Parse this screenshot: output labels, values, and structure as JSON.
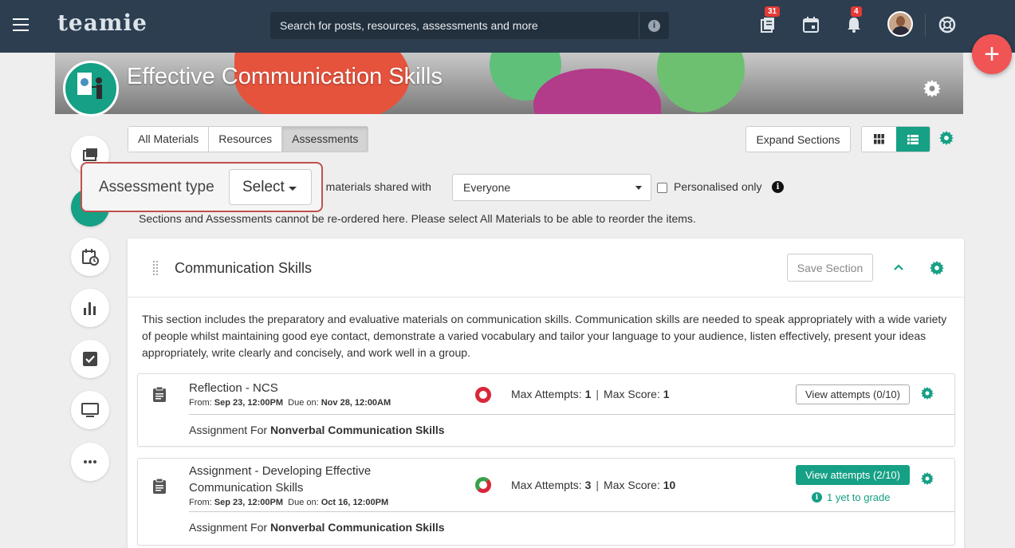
{
  "app": {
    "logo_text": "teamie",
    "accent_color": "#16a085",
    "topbar_color": "#2c3e50"
  },
  "search": {
    "placeholder": "Search for posts, resources, assessments and more",
    "info_icon": "info-icon"
  },
  "topbar": {
    "icons": [
      {
        "name": "materials-icon",
        "badge": "31"
      },
      {
        "name": "calendar-icon",
        "badge": ""
      },
      {
        "name": "bell-icon",
        "badge": "4"
      },
      {
        "name": "avatar",
        "badge": ""
      },
      {
        "name": "help-icon",
        "badge": ""
      }
    ]
  },
  "fab": {
    "label": "+"
  },
  "course": {
    "title": "Effective Communication Skills"
  },
  "tabs": [
    {
      "label": "All Materials",
      "active": false
    },
    {
      "label": "Resources",
      "active": false
    },
    {
      "label": "Assessments",
      "active": true
    }
  ],
  "toolbar": {
    "expand_label": "Expand Sections"
  },
  "filters": {
    "assessment_type_label": "Assessment type",
    "assessment_type_value": "Select",
    "shared_with_text": "g materials shared with",
    "shared_with_value": "Everyone",
    "personalised_label": "Personalised only",
    "personalised_checked": false
  },
  "notice": "Sections and Assessments cannot be re-ordered here. Please select All Materials to be able to reorder the items.",
  "section": {
    "title": "Communication Skills",
    "save_label": "Save Section",
    "description": "This section includes the preparatory and evaluative materials on communication skills. Communication skills are needed to speak appropriately with a wide variety of people whilst maintaining good eye contact, demonstrate a varied vocabulary and tailor your language to your audience, listen effectively, present your ideas appropriately, write clearly and concisely, and work well in a group.",
    "items": [
      {
        "title": "Reflection - NCS",
        "from_label": "From:",
        "from": "Sep 23, 12:00PM",
        "due_label": "Due on:",
        "due": "Nov 28, 12:00AM",
        "max_attempts_label": "Max Attempts:",
        "max_attempts": "1",
        "max_score_label": "Max Score:",
        "max_score": "1",
        "attempts_label": "View attempts (0/10)",
        "for_label": "Assignment For",
        "for_value": "Nonverbal Communication Skills",
        "grade_note": ""
      },
      {
        "title": "Assignment - Developing Effective Communication Skills",
        "from_label": "From:",
        "from": "Sep 23, 12:00PM",
        "due_label": "Due on:",
        "due": "Oct 16, 12:00PM",
        "max_attempts_label": "Max Attempts:",
        "max_attempts": "3",
        "max_score_label": "Max Score:",
        "max_score": "10",
        "attempts_label": "View attempts (2/10)",
        "for_label": "Assignment For",
        "for_value": "Nonverbal Communication Skills",
        "grade_note": "1 yet to grade"
      }
    ]
  },
  "sidenav": [
    "posts-icon",
    "materials-icon",
    "calendar-clock-icon",
    "bar-chart-icon",
    "checkbox-icon",
    "monitor-icon",
    "more-icon"
  ]
}
